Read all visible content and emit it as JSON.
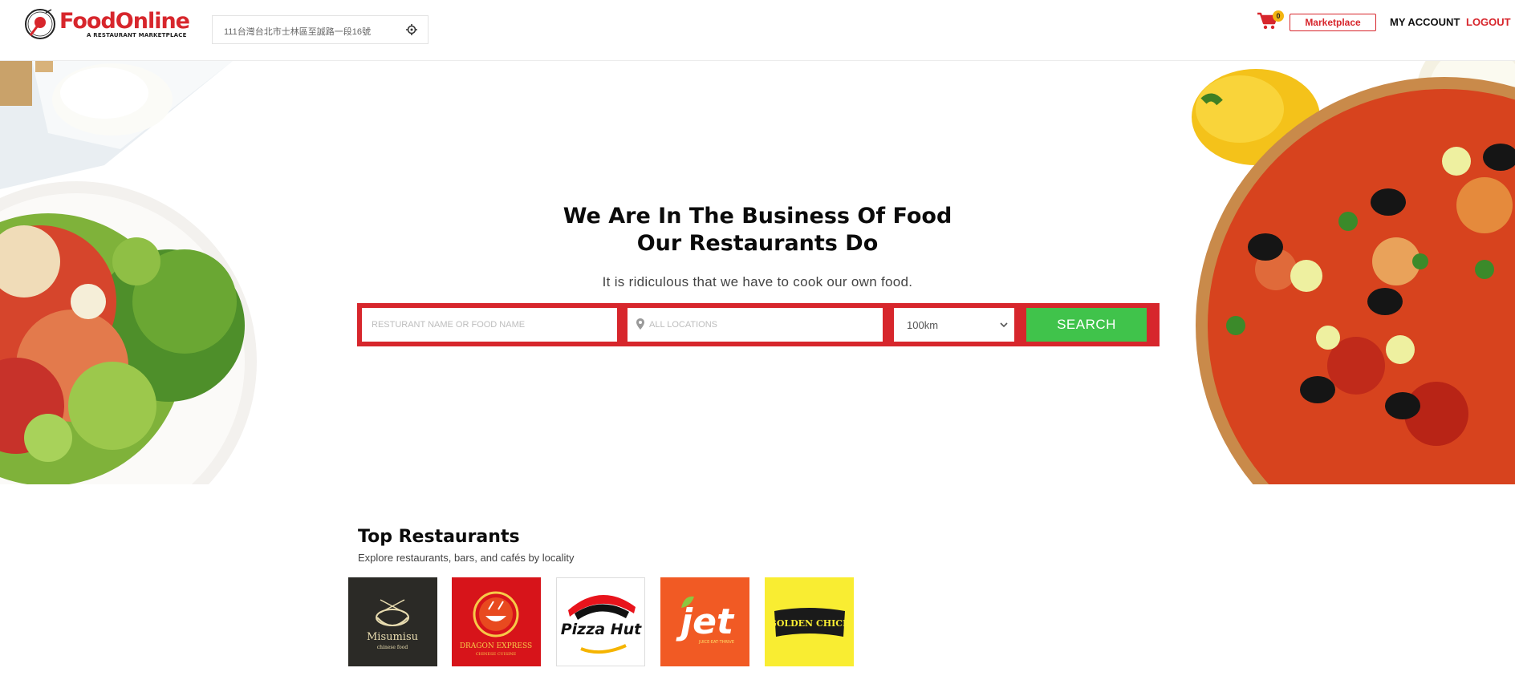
{
  "header": {
    "logo_text": "FoodOnline",
    "logo_tagline": "A RESTAURANT MARKETPLACE",
    "address": "111台灣台北市士林區至誠路一段16號",
    "cart_count": "0",
    "marketplace_label": "Marketplace",
    "my_account_label": "MY ACCOUNT",
    "logout_label": "LOGOUT"
  },
  "hero": {
    "title_line1": "We Are In The Business Of Food",
    "title_line2": "Our Restaurants Do",
    "subtitle": "It is ridiculous that we have to cook our own food.",
    "search": {
      "name_placeholder": "RESTURANT NAME OR FOOD NAME",
      "location_placeholder": "ALL LOCATIONS",
      "distance_value": "100km",
      "button_label": "SEARCH"
    }
  },
  "top_restaurants": {
    "title": "Top Restaurants",
    "subtitle": "Explore restaurants, bars, and cafés by locality",
    "items": [
      {
        "name": "Misumisu",
        "tagline": "chinese food",
        "bg": "#2b2a26"
      },
      {
        "name": "DRAGON EXPRESS",
        "tagline": "CHINESE CUISINE",
        "bg": "#d7141a"
      },
      {
        "name": "Pizza Hut",
        "tagline": "",
        "bg": "#ffffff"
      },
      {
        "name": "jet",
        "tagline": "JUICE·EAT·THRIVE",
        "bg": "#f15a24"
      },
      {
        "name": "GOLDEN CHICK",
        "tagline": "",
        "bg": "#f9ed32"
      }
    ]
  },
  "colors": {
    "brand_red": "#d7262c",
    "search_green": "#40c34b",
    "badge_yellow": "#f3b40f"
  },
  "icons": {
    "cart": "shopping-cart-icon",
    "locate": "crosshair-icon",
    "pin": "map-pin-icon",
    "caret": "chevron-down-icon"
  }
}
